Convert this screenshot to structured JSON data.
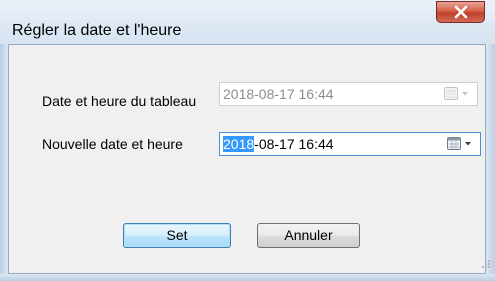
{
  "window": {
    "title": "Régler la date et l'heure"
  },
  "form": {
    "table_label": "Date et heure du tableau",
    "table_value": "2018-08-17   16:44",
    "new_label": "Nouvelle date et heure",
    "new_value_selected": "2018",
    "new_value_rest": "-08-17   16:44"
  },
  "buttons": {
    "set_label": "Set",
    "cancel_label": "Annuler"
  },
  "icons": {
    "close": "close-icon",
    "calendar": "calendar-dropdown-icon"
  },
  "colors": {
    "selection": "#3399ff",
    "close_button": "#c9432c"
  }
}
